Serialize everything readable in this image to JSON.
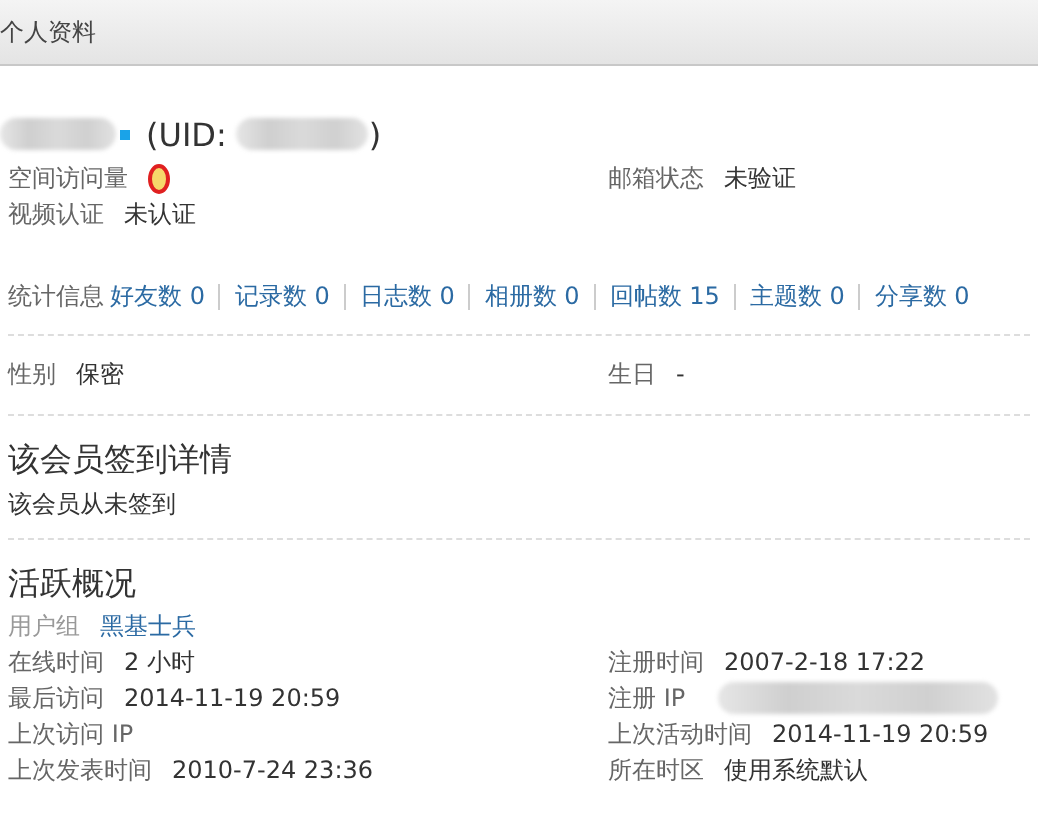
{
  "header": {
    "title": "个人资料"
  },
  "profile": {
    "uid_prefix": "(UID:",
    "uid_suffix": ")",
    "fields": [
      {
        "label": "空间访问量",
        "kind": "badge"
      },
      {
        "label": "邮箱状态",
        "value": "未验证",
        "kind": "text"
      },
      {
        "label": "视频认证",
        "value": "未认证",
        "kind": "text"
      }
    ]
  },
  "stats": {
    "label": "统计信息",
    "items": [
      "好友数 0",
      "记录数 0",
      "日志数 0",
      "相册数 0",
      "回帖数 15",
      "主题数 0",
      "分享数 0"
    ]
  },
  "basic": [
    {
      "label": "性别",
      "value": "保密"
    },
    {
      "label": "生日",
      "value": "-"
    }
  ],
  "signin": {
    "title": "该会员签到详情",
    "text": "该会员从未签到"
  },
  "activity": {
    "title": "活跃概况",
    "group_label": "用户组",
    "group_value": "黑基士兵",
    "fields": [
      {
        "label": "在线时间",
        "value": "2 小时",
        "kind": "text"
      },
      {
        "label": "注册时间",
        "value": "2007-2-18 17:22",
        "kind": "text"
      },
      {
        "label": "最后访问",
        "value": "2014-11-19 20:59",
        "kind": "text"
      },
      {
        "label": "注册 IP",
        "kind": "redacted"
      },
      {
        "label": "上次访问 IP",
        "kind": "empty"
      },
      {
        "label": "上次活动时间",
        "value": "2014-11-19 20:59",
        "kind": "text"
      },
      {
        "label": "上次发表时间",
        "value": "2010-7-24 23:36",
        "kind": "text"
      },
      {
        "label": "所在时区",
        "value": "使用系统默认",
        "kind": "text"
      }
    ]
  }
}
